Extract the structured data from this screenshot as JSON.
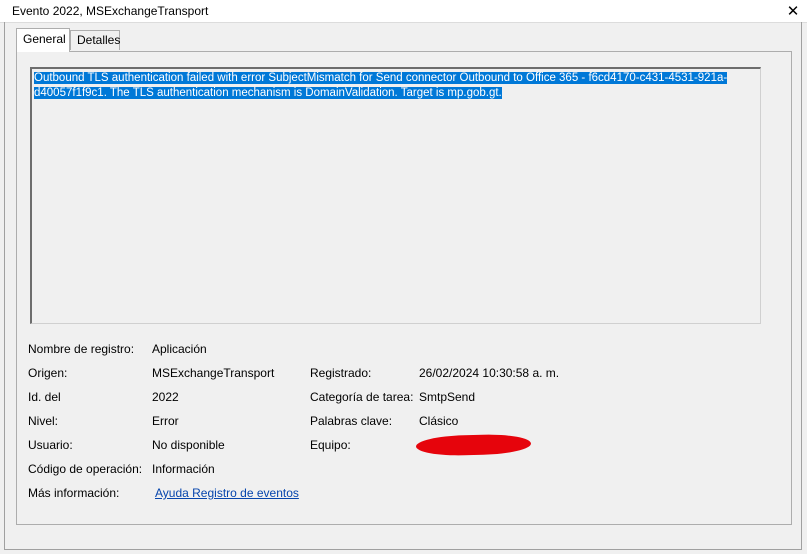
{
  "window": {
    "title": "Evento 2022, MSExchangeTransport",
    "close_glyph": "✕"
  },
  "tabs": [
    {
      "label": "General",
      "active": true
    },
    {
      "label": "Detalles",
      "active": false
    }
  ],
  "description": "Outbound TLS authentication failed with error SubjectMismatch for Send connector Outbound to Office 365 - f6cd4170-c431-4531-921a-d40057f1f9c1. The TLS authentication mechanism is DomainValidation. Target is mp.gob.gt.",
  "fields": {
    "log_name": {
      "label": "Nombre de registro:",
      "value": "Aplicación"
    },
    "source": {
      "label": "Origen:",
      "value": "MSExchangeTransport"
    },
    "logged": {
      "label": "Registrado:",
      "value": "26/02/2024 10:30:58 a. m."
    },
    "event_id": {
      "label": "Id. del",
      "value": "2022"
    },
    "task_category": {
      "label": "Categoría de tarea:",
      "value": "SmtpSend"
    },
    "level": {
      "label": "Nivel:",
      "value": "Error"
    },
    "keywords": {
      "label": "Palabras clave:",
      "value": "Clásico"
    },
    "user": {
      "label": "Usuario:",
      "value": "No disponible"
    },
    "computer": {
      "label": "Equipo:"
    },
    "opcode": {
      "label": "Código de operación:",
      "value": "Información"
    },
    "more_info": {
      "label": "Más información:",
      "link": "Ayuda Registro de eventos"
    }
  },
  "colors": {
    "selection": "#0078d7",
    "link": "#0645ad",
    "redaction": "#e6040c"
  }
}
